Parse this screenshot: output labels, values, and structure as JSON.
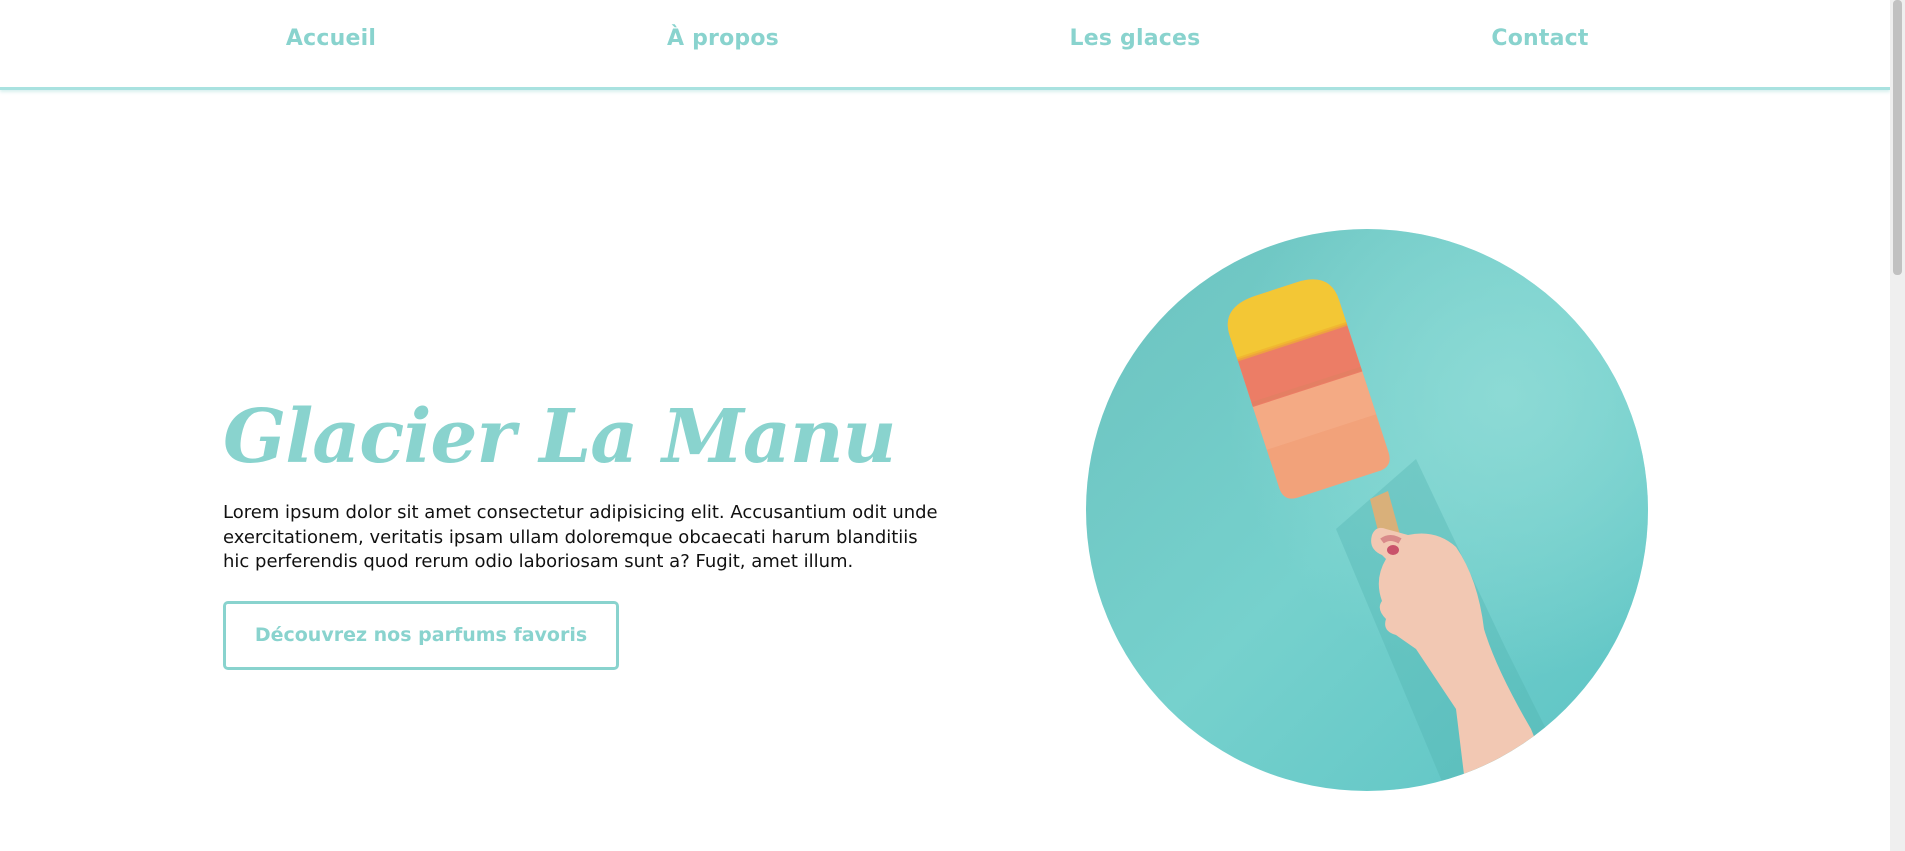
{
  "nav": {
    "items": [
      {
        "label": "Accueil"
      },
      {
        "label": "À propos"
      },
      {
        "label": "Les glaces"
      },
      {
        "label": "Contact"
      }
    ]
  },
  "hero": {
    "title": "Glacier La Manu",
    "description": "Lorem ipsum dolor sit amet consectetur adipisicing elit. Accusantium odit unde exercitationem, veritatis ipsam ullam doloremque obcaecati harum blanditiis hic perferendis quod rerum odio laboriosam sunt a? Fugit, amet illum.",
    "cta_label": "Découvrez nos parfums favoris",
    "image_icon": "popsicle-photo"
  },
  "colors": {
    "accent": "#89d3ce",
    "text": "#111111",
    "background": "#ffffff",
    "image_background": "#6dcdcb"
  }
}
